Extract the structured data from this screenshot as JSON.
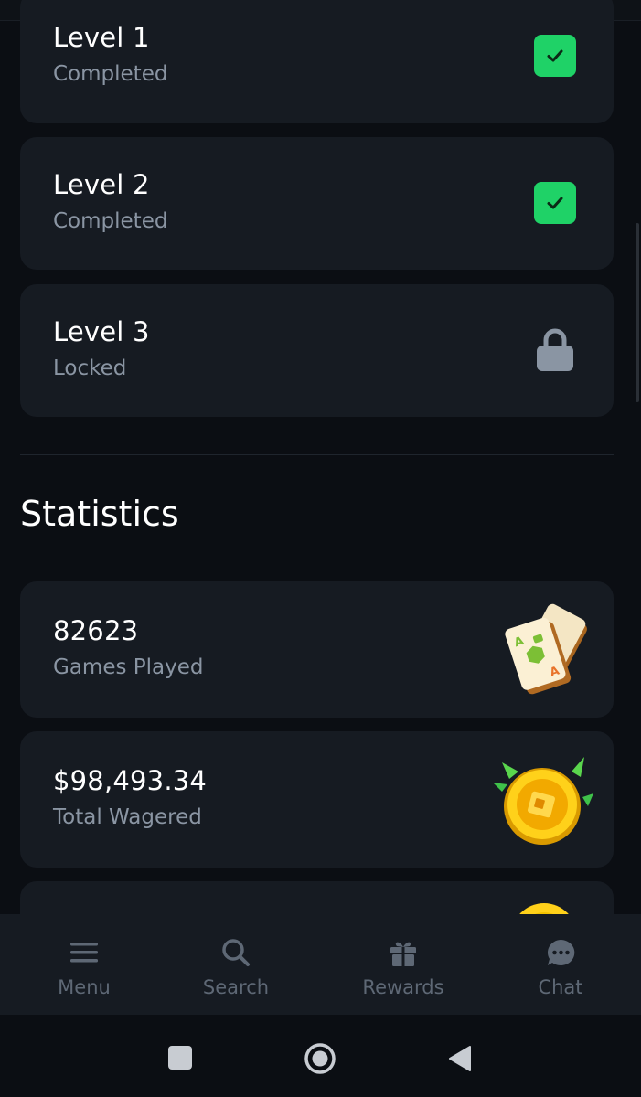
{
  "levels": [
    {
      "title": "Level 1",
      "status": "Completed",
      "state": "completed"
    },
    {
      "title": "Level 2",
      "status": "Completed",
      "state": "completed"
    },
    {
      "title": "Level 3",
      "status": "Locked",
      "state": "locked"
    }
  ],
  "statistics": {
    "title": "Statistics",
    "items": [
      {
        "value": "82623",
        "label": "Games Played",
        "icon": "mahjong-tiles-icon"
      },
      {
        "value": "$98,493.34",
        "label": "Total Wagered",
        "icon": "gold-coin-icon"
      },
      {
        "value": "",
        "label": "",
        "icon": "gold-coin-icon"
      }
    ]
  },
  "nav": {
    "items": [
      {
        "label": "Menu",
        "icon": "menu-icon"
      },
      {
        "label": "Search",
        "icon": "search-icon"
      },
      {
        "label": "Rewards",
        "icon": "gift-icon"
      },
      {
        "label": "Chat",
        "icon": "chat-icon"
      }
    ]
  },
  "colors": {
    "background": "#0b0e13",
    "card": "#161b22",
    "accent_green": "#1fd267",
    "muted_text": "#8a95a3"
  }
}
